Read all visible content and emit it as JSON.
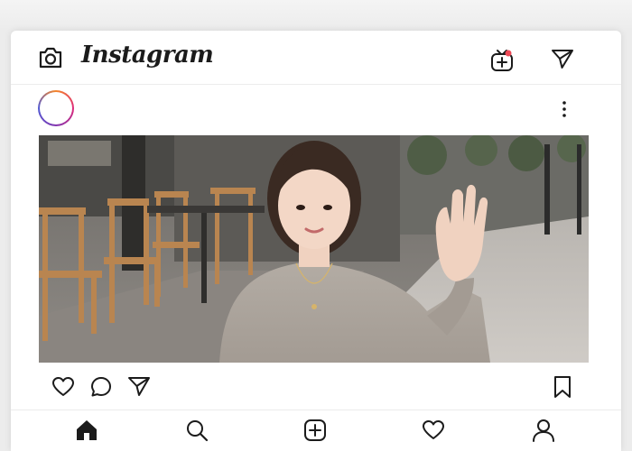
{
  "app": {
    "brand_name": "Instagram"
  },
  "header": {
    "icons": [
      "camera-icon",
      "igtv-icon",
      "direct-message-icon"
    ]
  },
  "post": {
    "avatar_ring_colors": [
      "#f58529",
      "#dd2a7b",
      "#8134af",
      "#515bd4"
    ],
    "menu_icon": "more-options-icon",
    "image_subject": "photo",
    "actions": [
      "like-icon",
      "comment-icon",
      "share-icon",
      "save-icon"
    ]
  },
  "bottom_nav": {
    "items": [
      "home-icon",
      "search-icon",
      "new-post-icon",
      "activity-icon",
      "profile-icon"
    ],
    "active": "home-icon"
  },
  "colors": {
    "icon": "#1b1b1b",
    "notification_dot": "#ed4956",
    "background": "#ececec",
    "card": "#ffffff"
  }
}
